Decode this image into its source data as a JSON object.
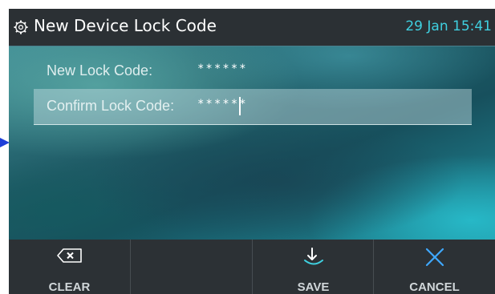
{
  "header": {
    "title": "New Device Lock Code",
    "datetime": "29 Jan 15:41",
    "icon": "gear-icon"
  },
  "form": {
    "new_code": {
      "label": "New Lock Code:",
      "value": "******"
    },
    "confirm_code": {
      "label": "Confirm Lock Code:",
      "value": "******"
    }
  },
  "softkeys": {
    "clear": {
      "label": "CLEAR",
      "icon": "backspace-icon"
    },
    "save": {
      "label": "SAVE",
      "icon": "save-arrow-icon"
    },
    "cancel": {
      "label": "CANCEL",
      "icon": "close-icon"
    }
  },
  "colors": {
    "accent": "#3fd0e0",
    "titlebar": "#2b3034",
    "softkey_bar": "#2c3135",
    "marker": "#1f3fd9"
  }
}
